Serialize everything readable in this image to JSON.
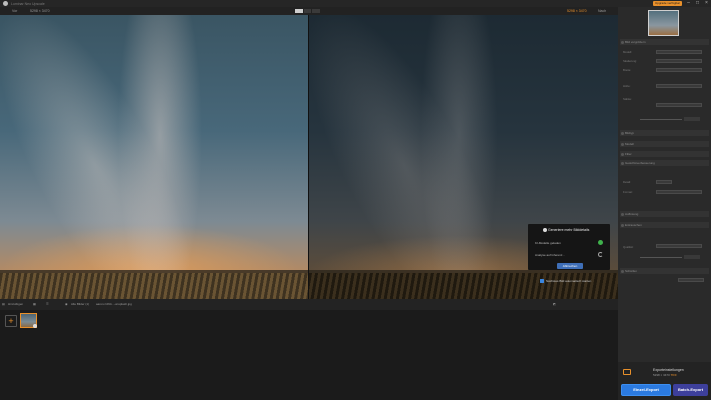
{
  "colors": {
    "accent": "#e8902b",
    "primary_button": "#2b7ae0",
    "batch_button": "#3d3f9c",
    "success": "#3fb24c"
  },
  "titlebar": {
    "title": "Luminar Neo Upscale",
    "upgrade_label": "Upgrade verfügbar",
    "min_icon": "minimize-icon",
    "max_icon": "maximize-icon",
    "close_icon": "close-icon"
  },
  "viewbar": {
    "before_label": "Vor",
    "before_size": "5298 × 3470",
    "after_size": "5298 × 3470",
    "after_label": "Nach"
  },
  "dialog": {
    "title": "Generiere mehr Bilddetails",
    "row1": "KI-Modelle geladen",
    "row2": "Analyse auf Inferenz...",
    "cancel": "Abbrechen",
    "auto_label": "Nächstes Bild automatisch starten"
  },
  "bottombar": {
    "add_label": "Hinzufügen",
    "count_label": "Alle Bilder (1)",
    "file_name": "aaron-f-094...-unsplash.jpg"
  },
  "panel": {
    "sections": [
      "Bild vergrößern",
      "Bildtyp",
      "Modell",
      "Filter",
      "Gesichtsverbesserung",
      "Auflösung",
      "Entrauschen",
      "Schärfen",
      "Ausgabe"
    ],
    "rows": [
      "Modell:",
      "Skalierung:",
      "Breite:",
      "Höhe:",
      "Stärke:",
      "Detail:",
      "Format:",
      "Qualität:"
    ]
  },
  "export": {
    "title": "Exporteinstellungen",
    "size": "5298 × 3470",
    "format": "TIFF",
    "single_label": "Einzel-Export",
    "batch_label": "Batch-Export"
  }
}
